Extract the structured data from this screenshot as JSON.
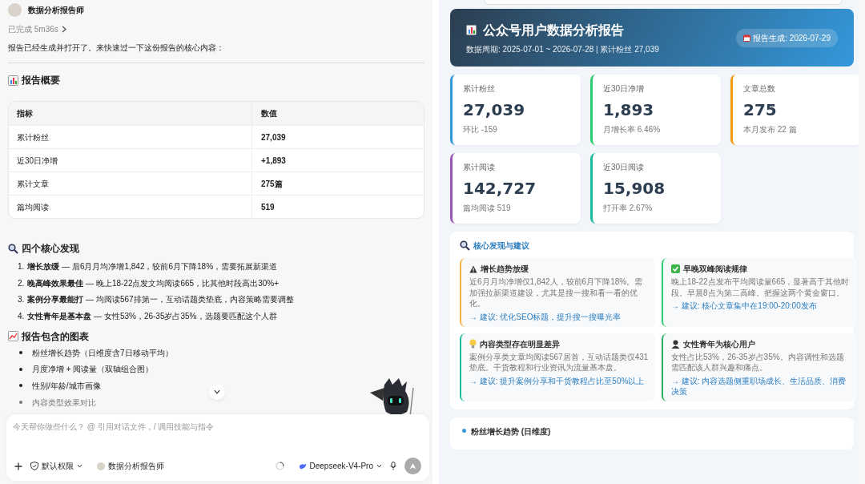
{
  "chat": {
    "assistant_name": "数据分析报告师",
    "status": "已完成 5m36s",
    "intro": "报告已经生成并打开了。来快速过一下这份报告的核心内容：",
    "overview": {
      "heading": "报告概要",
      "columns": [
        "指标",
        "数值"
      ],
      "rows": [
        [
          "累计粉丝",
          "27,039"
        ],
        [
          "近30日净增",
          "+1,893"
        ],
        [
          "累计文章",
          "275篇"
        ],
        [
          "篇均阅读",
          "519"
        ]
      ]
    },
    "findings": {
      "heading": "四个核心发现",
      "items": [
        {
          "number": "1.",
          "text": "**增长放缓** — 后6月月均净增1,842，较前6月下降18%，需要拓展新渠道"
        },
        {
          "number": "2.",
          "text": "**晚高峰效果最佳** — 晚上18-22点发文均阅读665，比其他时段高出30%+"
        },
        {
          "number": "3.",
          "text": "**案例分享最能打** — 均阅读567排第一，互动话题类垫底，内容策略需要调整"
        },
        {
          "number": "4.",
          "text": "**女性青年是基本盘** — 女性53%，26-35岁占35%，选题要匹配这个人群"
        }
      ]
    },
    "charts": {
      "heading": "报告包含的图表",
      "items": [
        {
          "text": "粉丝增长趋势（日维度含7日移动平均）",
          "faded": false
        },
        {
          "text": "月度净增 + 阅读量（双轴组合图）",
          "faded": false
        },
        {
          "text": "性别/年龄/城市画像",
          "faded": false
        },
        {
          "text": "内容类型效果对比",
          "faded": true
        }
      ]
    },
    "composer": {
      "placeholder": "今天帮你做些什么？ @ 引用对话文件，/ 调用技能与指令",
      "permission": "默认权限",
      "agent": "数据分析报告师",
      "model": "Deepseek-V4-Pro"
    }
  },
  "report": {
    "title": "公众号用户数据分析报告",
    "subtitle": "数据周期: 2025-07-01 ~ 2026-07-28 | 累计粉丝 27,039",
    "date_badge": "报告生成: 2026-07-29",
    "stats": [
      {
        "label": "累计粉丝",
        "value": "27,039",
        "note": "环比 -159",
        "color": "#3498db"
      },
      {
        "label": "近30日净增",
        "value": "1,893",
        "note": "月增长率 6.46%",
        "color": "#2ecc71"
      },
      {
        "label": "文章总数",
        "value": "275",
        "note": "本月发布 22 篇",
        "color": "#f39c12"
      },
      {
        "label": "累计阅读",
        "value": "142,727",
        "note": "篇均阅读 519",
        "color": "#9b59b6"
      },
      {
        "label": "近30日阅读",
        "value": "15,908",
        "note": "打开率 2.67%",
        "color": "#1abc9c"
      }
    ],
    "insights": {
      "heading": "核心发现与建议",
      "cards": [
        {
          "kind": "warning",
          "title": "增长趋势放缓",
          "body": "近6月月均净增仅1,842人，较前6月下降18%。需加强拉新渠道建设，尤其是搜一搜和看一看的优化。",
          "advice": "→ 建议: 优化SEO标题，提升搜一搜曝光率",
          "color": "#f5b041"
        },
        {
          "kind": "check",
          "title": "早晚双峰阅读规律",
          "body": "晚上18-22点发布平均阅读量665，显著高于其他时段。早晨8点为第二高峰。把握这两个黄金窗口。",
          "advice": "→ 建议: 核心文章集中在19:00-20:00发布",
          "color": "#2ecc71"
        },
        {
          "kind": "bulb",
          "title": "内容类型存在明显差异",
          "body": "案例分享类文章均阅读567居首，互动话题类仅431垫底。干货教程和行业资讯为流量基本盘。",
          "advice": "→ 建议: 提升案例分享和干货教程占比至50%以上",
          "color": "#1abc9c"
        },
        {
          "kind": "person",
          "title": "女性青年为核心用户",
          "body": "女性占比53%，26-35岁占35%。内容调性和选题需匹配该人群兴趣和痛点。",
          "advice": "→ 建议: 内容选题侧重职场成长、生活品质、消费决策",
          "color": "#27ae60"
        }
      ]
    },
    "next_section": "粉丝增长趋势 (日维度)"
  }
}
